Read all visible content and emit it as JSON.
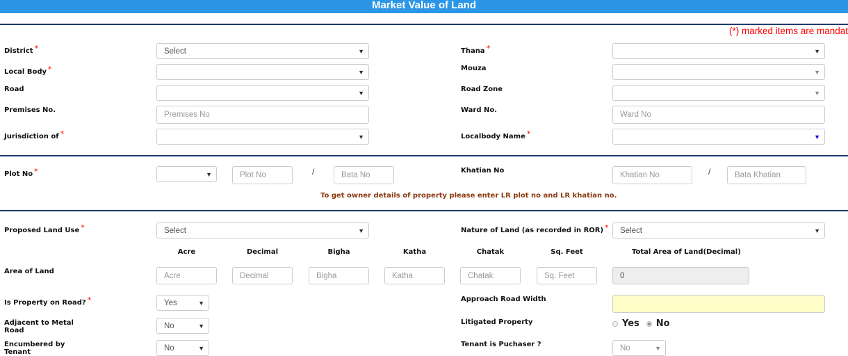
{
  "header": {
    "title": "Market Value of Land"
  },
  "mandatory_note": "(*) marked items are mandat",
  "section1": {
    "district": {
      "label": "District",
      "required": "*",
      "value": "Select"
    },
    "thana": {
      "label": "Thana",
      "required": "*",
      "value": ""
    },
    "local_body": {
      "label": "Local Body",
      "required": "*",
      "value": ""
    },
    "mouza": {
      "label": "Mouza",
      "value": ""
    },
    "road": {
      "label": "Road",
      "value": ""
    },
    "road_zone": {
      "label": "Road Zone",
      "value": ""
    },
    "premises_no": {
      "label": "Premises No.",
      "placeholder": "Premises No"
    },
    "ward_no": {
      "label": "Ward No.",
      "placeholder": "Ward No"
    },
    "jurisdiction": {
      "label": "Jurisdiction of",
      "required": "*",
      "value": ""
    },
    "localbody_name": {
      "label": "Localbody Name",
      "required": "*",
      "value": ""
    }
  },
  "section2": {
    "plot_no": {
      "label": "Plot No",
      "required": "*",
      "select_value": "",
      "placeholder": "Plot No",
      "bata_placeholder": "Bata No"
    },
    "khatian_no": {
      "label": "Khatian No",
      "placeholder": "Khatian No",
      "bata_placeholder": "Bata Khatian"
    },
    "separator": "/",
    "hint": "To get owner details of property please enter LR plot no and LR khatian no."
  },
  "section3": {
    "proposed_land_use": {
      "label": "Proposed Land Use",
      "required": "*",
      "value": "Select"
    },
    "nature_of_land": {
      "label": "Nature of Land (as recorded in ROR)",
      "required": "*",
      "value": "Select"
    },
    "area_of_land": {
      "label": "Area of Land",
      "columns": [
        {
          "header": "Acre",
          "placeholder": "Acre"
        },
        {
          "header": "Decimal",
          "placeholder": "Decimal"
        },
        {
          "header": "Bigha",
          "placeholder": "Bigha"
        },
        {
          "header": "Katha",
          "placeholder": "Katha"
        },
        {
          "header": "Chatak",
          "placeholder": "Chatak"
        },
        {
          "header": "Sq. Feet",
          "placeholder": "Sq. Feet"
        }
      ],
      "total": {
        "header": "Total Area of Land(Decimal)",
        "value": "0"
      }
    },
    "property_on_road": {
      "label": "Is Property on Road?",
      "required": "*",
      "value": "Yes"
    },
    "approach_road_width": {
      "label": "Approach Road Width",
      "value": ""
    },
    "adjacent_metal_road": {
      "label": "Adjacent to Metal Road",
      "value": "No"
    },
    "litigated_property": {
      "label": "Litigated Property",
      "options": [
        "Yes",
        "No"
      ],
      "selected": "No"
    },
    "encumbered_by_tenant": {
      "label": "Encumbered by Tenant",
      "value": "No"
    },
    "tenant_is_purchaser": {
      "label": "Tenant is Puchaser ?",
      "value": "No"
    }
  },
  "icons": {
    "dropdown": "▼"
  }
}
